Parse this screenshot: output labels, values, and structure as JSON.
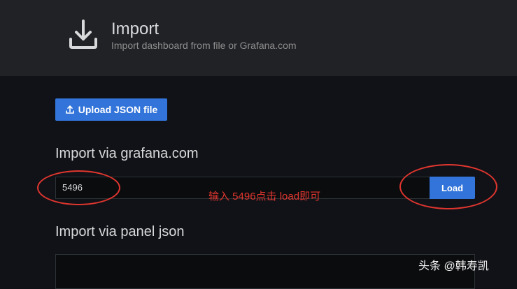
{
  "header": {
    "icon": "download-icon",
    "title": "Import",
    "subtitle": "Import dashboard from file or Grafana.com"
  },
  "upload": {
    "icon": "upload-icon",
    "label": "Upload JSON file"
  },
  "grafana_section": {
    "title": "Import via grafana.com",
    "input_value": "5496",
    "load_label": "Load"
  },
  "annotation": "输入 5496点击 load即可",
  "json_section": {
    "title": "Import via panel json"
  },
  "watermark": "头条 @韩寿凯",
  "colors": {
    "accent": "#3274d9",
    "annotation": "#e0362f",
    "header_bg": "#212226",
    "body_bg": "#111217"
  }
}
